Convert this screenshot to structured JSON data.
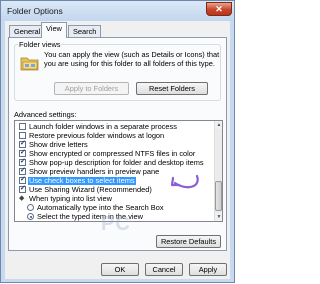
{
  "window": {
    "title": "Folder Options",
    "close_glyph": "✕"
  },
  "tabs": [
    {
      "label": "General",
      "active": false
    },
    {
      "label": "View",
      "active": true
    },
    {
      "label": "Search",
      "active": false
    }
  ],
  "folder_views": {
    "legend": "Folder views",
    "description": "You can apply the view (such as Details or Icons) that you are using for this folder to all folders of this type.",
    "apply_button": "Apply to Folders",
    "reset_button": "Reset Folders",
    "icon": "folder-icon"
  },
  "advanced": {
    "label": "Advanced settings:",
    "items": [
      {
        "type": "checkbox",
        "label": "Launch folder windows in a separate process",
        "checked": false,
        "indent": 1
      },
      {
        "type": "checkbox",
        "label": "Restore previous folder windows at logon",
        "checked": false,
        "indent": 1
      },
      {
        "type": "checkbox",
        "label": "Show drive letters",
        "checked": true,
        "indent": 1
      },
      {
        "type": "checkbox",
        "label": "Show encrypted or compressed NTFS files in color",
        "checked": true,
        "indent": 1
      },
      {
        "type": "checkbox",
        "label": "Show pop-up description for folder and desktop items",
        "checked": true,
        "indent": 1
      },
      {
        "type": "checkbox",
        "label": "Show preview handlers in preview pane",
        "checked": true,
        "indent": 1
      },
      {
        "type": "checkbox",
        "label": "Use check boxes to select items",
        "checked": true,
        "indent": 1,
        "highlighted": true
      },
      {
        "type": "checkbox",
        "label": "Use Sharing Wizard (Recommended)",
        "checked": true,
        "indent": 1
      },
      {
        "type": "group",
        "label": "When typing into list view",
        "indent": 1
      },
      {
        "type": "radio",
        "label": "Automatically type into the Search Box",
        "checked": false,
        "indent": 2
      },
      {
        "type": "radio",
        "label": "Select the typed item in the view",
        "checked": true,
        "indent": 2
      }
    ]
  },
  "restore_defaults": "Restore Defaults",
  "footer": {
    "ok": "OK",
    "cancel": "Cancel",
    "apply": "Apply"
  },
  "watermark": "PC",
  "colors": {
    "highlight": "#3399ff",
    "arrow": "#8a5ed6"
  }
}
